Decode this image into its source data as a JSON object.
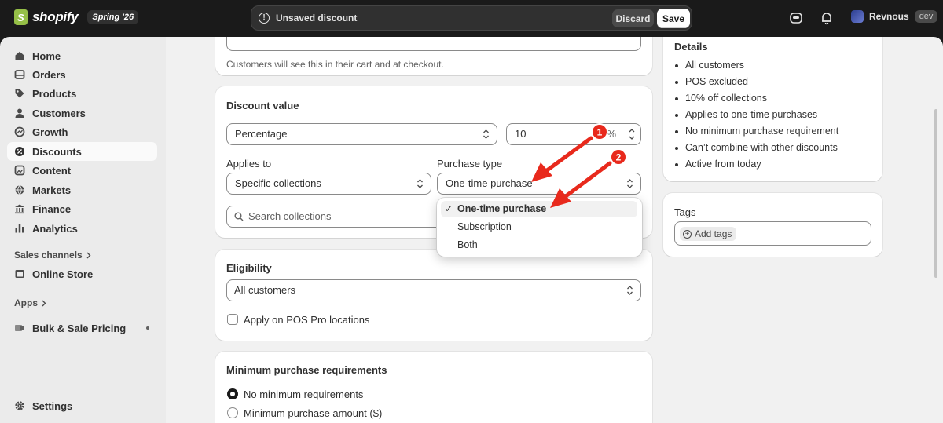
{
  "topbar": {
    "brand": "shopify",
    "season": "Spring '26",
    "savebar_message": "Unsaved discount",
    "discard_label": "Discard",
    "save_label": "Save",
    "store_name": "Revnous",
    "store_badge": "dev"
  },
  "sidebar": {
    "items": [
      {
        "label": "Home",
        "icon": "home-icon"
      },
      {
        "label": "Orders",
        "icon": "orders-icon"
      },
      {
        "label": "Products",
        "icon": "tag-icon"
      },
      {
        "label": "Customers",
        "icon": "person-icon"
      },
      {
        "label": "Growth",
        "icon": "growth-icon"
      },
      {
        "label": "Discounts",
        "icon": "discount-icon"
      },
      {
        "label": "Content",
        "icon": "content-icon"
      },
      {
        "label": "Markets",
        "icon": "globe-icon"
      },
      {
        "label": "Finance",
        "icon": "bank-icon"
      },
      {
        "label": "Analytics",
        "icon": "bar-chart-icon"
      }
    ],
    "sales_channels_label": "Sales channels",
    "online_store_label": "Online Store",
    "apps_label": "Apps",
    "bulk_pricing_label": "Bulk & Sale Pricing",
    "settings_label": "Settings"
  },
  "title_card": {
    "help_text": "Customers will see this in their cart and at checkout."
  },
  "discount_value": {
    "title": "Discount value",
    "type_value": "Percentage",
    "amount_value": "10",
    "amount_suffix": "%",
    "applies_to_label": "Applies to",
    "applies_to_value": "Specific collections",
    "purchase_type_label": "Purchase type",
    "purchase_type_value": "One-time purchase",
    "search_placeholder": "Search collections"
  },
  "purchase_dropdown": {
    "options": [
      "One-time purchase",
      "Subscription",
      "Both"
    ],
    "selected": "One-time purchase"
  },
  "eligibility": {
    "title": "Eligibility",
    "value": "All customers",
    "pos_label": "Apply on POS Pro locations"
  },
  "minimum": {
    "title": "Minimum purchase requirements",
    "option_none": "No minimum requirements",
    "option_amount": "Minimum purchase amount ($)"
  },
  "details": {
    "title": "Details",
    "items": [
      "All customers",
      "POS excluded",
      "10% off collections",
      "Applies to one-time purchases",
      "No minimum purchase requirement",
      "Can’t combine with other discounts",
      "Active from today"
    ]
  },
  "tags": {
    "title": "Tags",
    "add_label": "Add tags"
  },
  "annotations": {
    "marker_1": "1",
    "marker_2": "2",
    "color": "#e8291c"
  }
}
